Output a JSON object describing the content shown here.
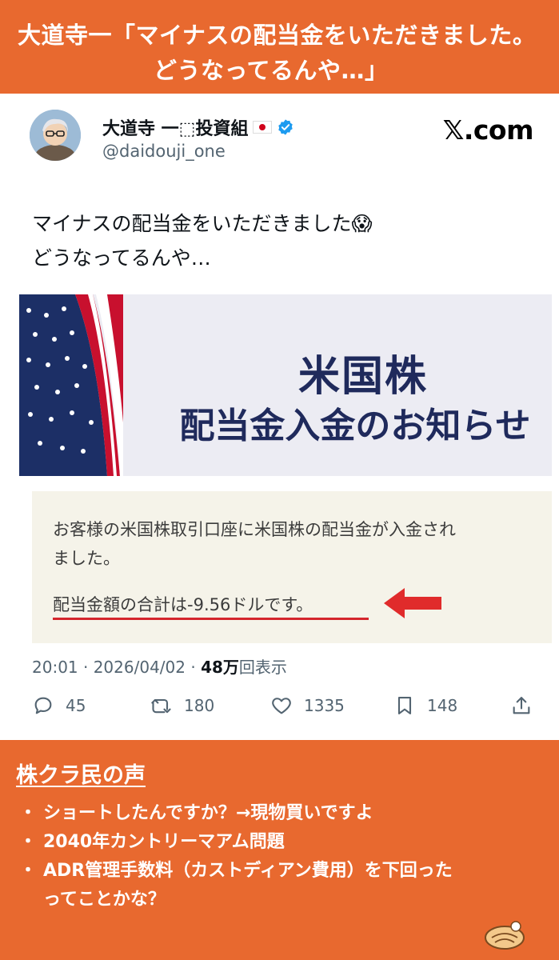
{
  "banner": {
    "line1": "大道寺一「マイナスの配当金をいただきました。",
    "line2": "どうなってるんや…」"
  },
  "tweet": {
    "display_name": "大道寺 一⬚投資組",
    "handle": "@daidouji_one",
    "source": "𝕏.com",
    "text_line1": "マイナスの配当金をいただきました😱",
    "text_line2": "どうなってるんや…",
    "image": {
      "title1": "米国株",
      "title2": "配当金入金のお知らせ"
    },
    "detail": {
      "line1": "お客様の米国株取引口座に米国株の配当金が入金され",
      "line2": "ました。",
      "amount_line": "配当金額の合計は-9.56ドルです。"
    },
    "meta": {
      "time": "20:01 · 2026/04/02 · ",
      "views_count": "48万",
      "views_label": "回表示"
    },
    "actions": {
      "replies": "45",
      "retweets": "180",
      "likes": "1335",
      "bookmarks": "148"
    }
  },
  "voices": {
    "title": "株クラ民の声",
    "items": [
      "ショートしたんですか？→現物買いですよ",
      "2040年カントリーマアム問題",
      "ADR管理手数料（カストディアン費用）を下回った",
      "ってことかな？"
    ]
  },
  "colors": {
    "banner_bg": "#e8692f",
    "notice_navy": "#1f2a5c",
    "highlight_red": "#d4262d",
    "verified_blue": "#1d9bf0"
  }
}
